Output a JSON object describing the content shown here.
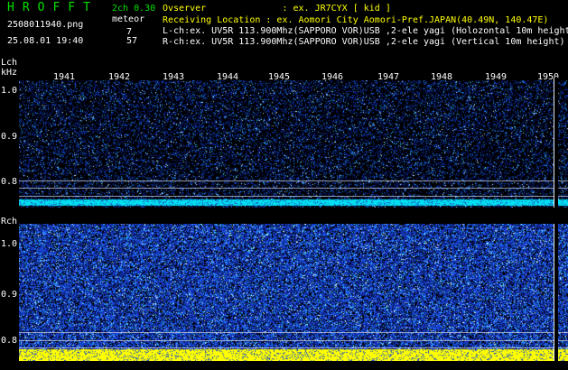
{
  "header": {
    "logo": "HROFFT",
    "filename": "2508011940.png",
    "datetime": "25.08.01 19:40",
    "version": "2ch 0.30",
    "meteor_label": "meteor",
    "count_l": "7",
    "count_r": "57",
    "observer_line": "Ovserver              : ex. JR7CYX [ kid ]",
    "location_line": "Receiving Location : ex. Aomori City Aomori-Pref.JAPAN(40.49N, 140.47E)",
    "lch_line": "L-ch:ex. UV5R 113.900Mhz(SAPPORO VOR)USB ,2-ele yagi (Holozontal 10m height",
    "rch_line": "R-ch:ex. UV5R 113.900Mhz(SAPPORO VOR)USB ,2-ele yagi (Vertical 10m height)"
  },
  "time_axis": {
    "labels": [
      "1941",
      "1942",
      "1943",
      "1944",
      "1945",
      "1946",
      "1947",
      "1948",
      "1949",
      "1950"
    ]
  },
  "lch": {
    "title": "Lch",
    "unit": "kHz",
    "ticks": [
      "1.0",
      "0.9",
      "0.8"
    ]
  },
  "rch": {
    "title": "Rch",
    "ticks": [
      "1.0",
      "0.9",
      "0.8"
    ]
  },
  "colors": {
    "background": "#000000",
    "header_green": "#00e000",
    "header_yellow": "#ffff00",
    "lch_noise": "#0a1a8a",
    "rch_noise": "#1d3cb8",
    "lch_band": "#00e0f0",
    "rch_band": "#ffff00"
  }
}
